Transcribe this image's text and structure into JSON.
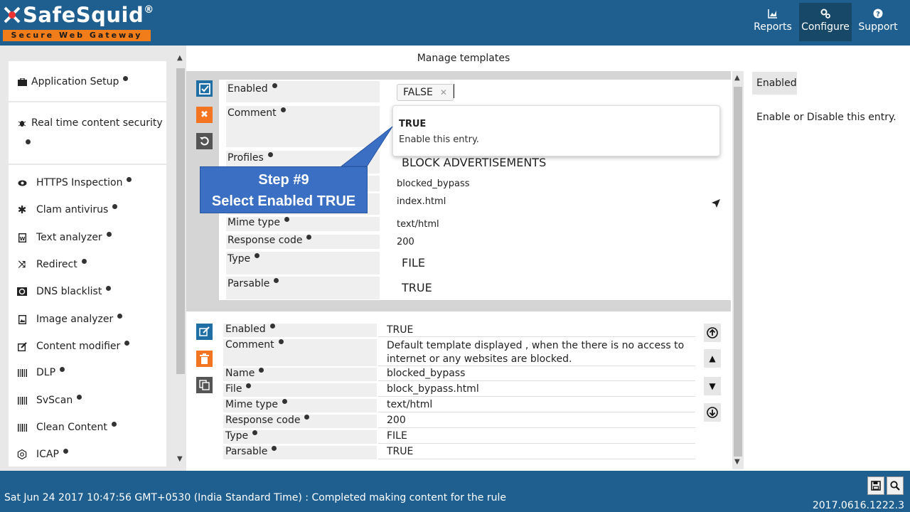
{
  "app": {
    "logo_name": "SafeSquid",
    "logo_reg": "®",
    "logo_tagline": "Secure Web Gateway"
  },
  "nav": [
    {
      "label": "Reports",
      "icon": "chart-icon",
      "active": false
    },
    {
      "label": "Configure",
      "icon": "gears-icon",
      "active": true
    },
    {
      "label": "Support",
      "icon": "question-icon",
      "active": false
    }
  ],
  "sidebar": {
    "groups": [
      {
        "label": "Application Setup",
        "icon": "briefcase-icon"
      },
      {
        "label": "Real time content security",
        "icon": "bug-icon"
      }
    ],
    "items": [
      {
        "label": "HTTPS Inspection",
        "icon": "eye-icon"
      },
      {
        "label": "Clam antivirus",
        "icon": "asterisk-icon"
      },
      {
        "label": "Text analyzer",
        "icon": "file-word-icon"
      },
      {
        "label": "Redirect",
        "icon": "random-icon"
      },
      {
        "label": "DNS blacklist",
        "icon": "blacklist-icon"
      },
      {
        "label": "Image analyzer",
        "icon": "file-image-icon"
      },
      {
        "label": "Content modifier",
        "icon": "edit-icon"
      },
      {
        "label": "DLP",
        "icon": "barcode-icon"
      },
      {
        "label": "SvScan",
        "icon": "barcode-icon"
      },
      {
        "label": "Clean Content",
        "icon": "barcode-icon"
      },
      {
        "label": "ICAP",
        "icon": "gear-icon"
      }
    ]
  },
  "main": {
    "title": "Manage templates",
    "edit": {
      "fields": [
        {
          "label": "Enabled",
          "value": ""
        },
        {
          "label": "Comment",
          "value": ""
        },
        {
          "label": "Profiles",
          "value": "BLOCK ADVERTISEMENTS"
        },
        {
          "label": "",
          "value": "blocked_bypass"
        },
        {
          "label": "",
          "value": "index.html"
        },
        {
          "label": "Mime type",
          "value": "text/html"
        },
        {
          "label": "Response code",
          "value": "200"
        },
        {
          "label": "Type",
          "value": "FILE"
        },
        {
          "label": "Parsable",
          "value": "TRUE"
        }
      ],
      "enabled_chip": "FALSE",
      "dropdown_option_title": "TRUE",
      "dropdown_option_desc": "Enable this entry."
    },
    "callout": {
      "line1": "Step #9",
      "line2": "Select Enabled TRUE"
    },
    "record": {
      "fields": [
        {
          "label": "Enabled",
          "value": "TRUE"
        },
        {
          "label": "Comment",
          "value": "Default template displayed , when the there is no access to internet or any websites are blocked."
        },
        {
          "label": "Name",
          "value": "blocked_bypass"
        },
        {
          "label": "File",
          "value": "block_bypass.html"
        },
        {
          "label": "Mime type",
          "value": "text/html"
        },
        {
          "label": "Response code",
          "value": "200"
        },
        {
          "label": "Type",
          "value": "FILE"
        },
        {
          "label": "Parsable",
          "value": "TRUE"
        }
      ]
    }
  },
  "help": {
    "tag": "Enabled",
    "text": "Enable or Disable this entry."
  },
  "footer": {
    "status": "Sat Jun 24 2017 10:47:56 GMT+0530 (India Standard Time) : Completed making content for the rule",
    "version": "2017.0616.1222.3"
  },
  "colors": {
    "header_bg": "#1f5f8f",
    "accent_orange": "#f37421",
    "accent_blue": "#1f6fa5",
    "callout_blue": "#3a6fc4"
  }
}
